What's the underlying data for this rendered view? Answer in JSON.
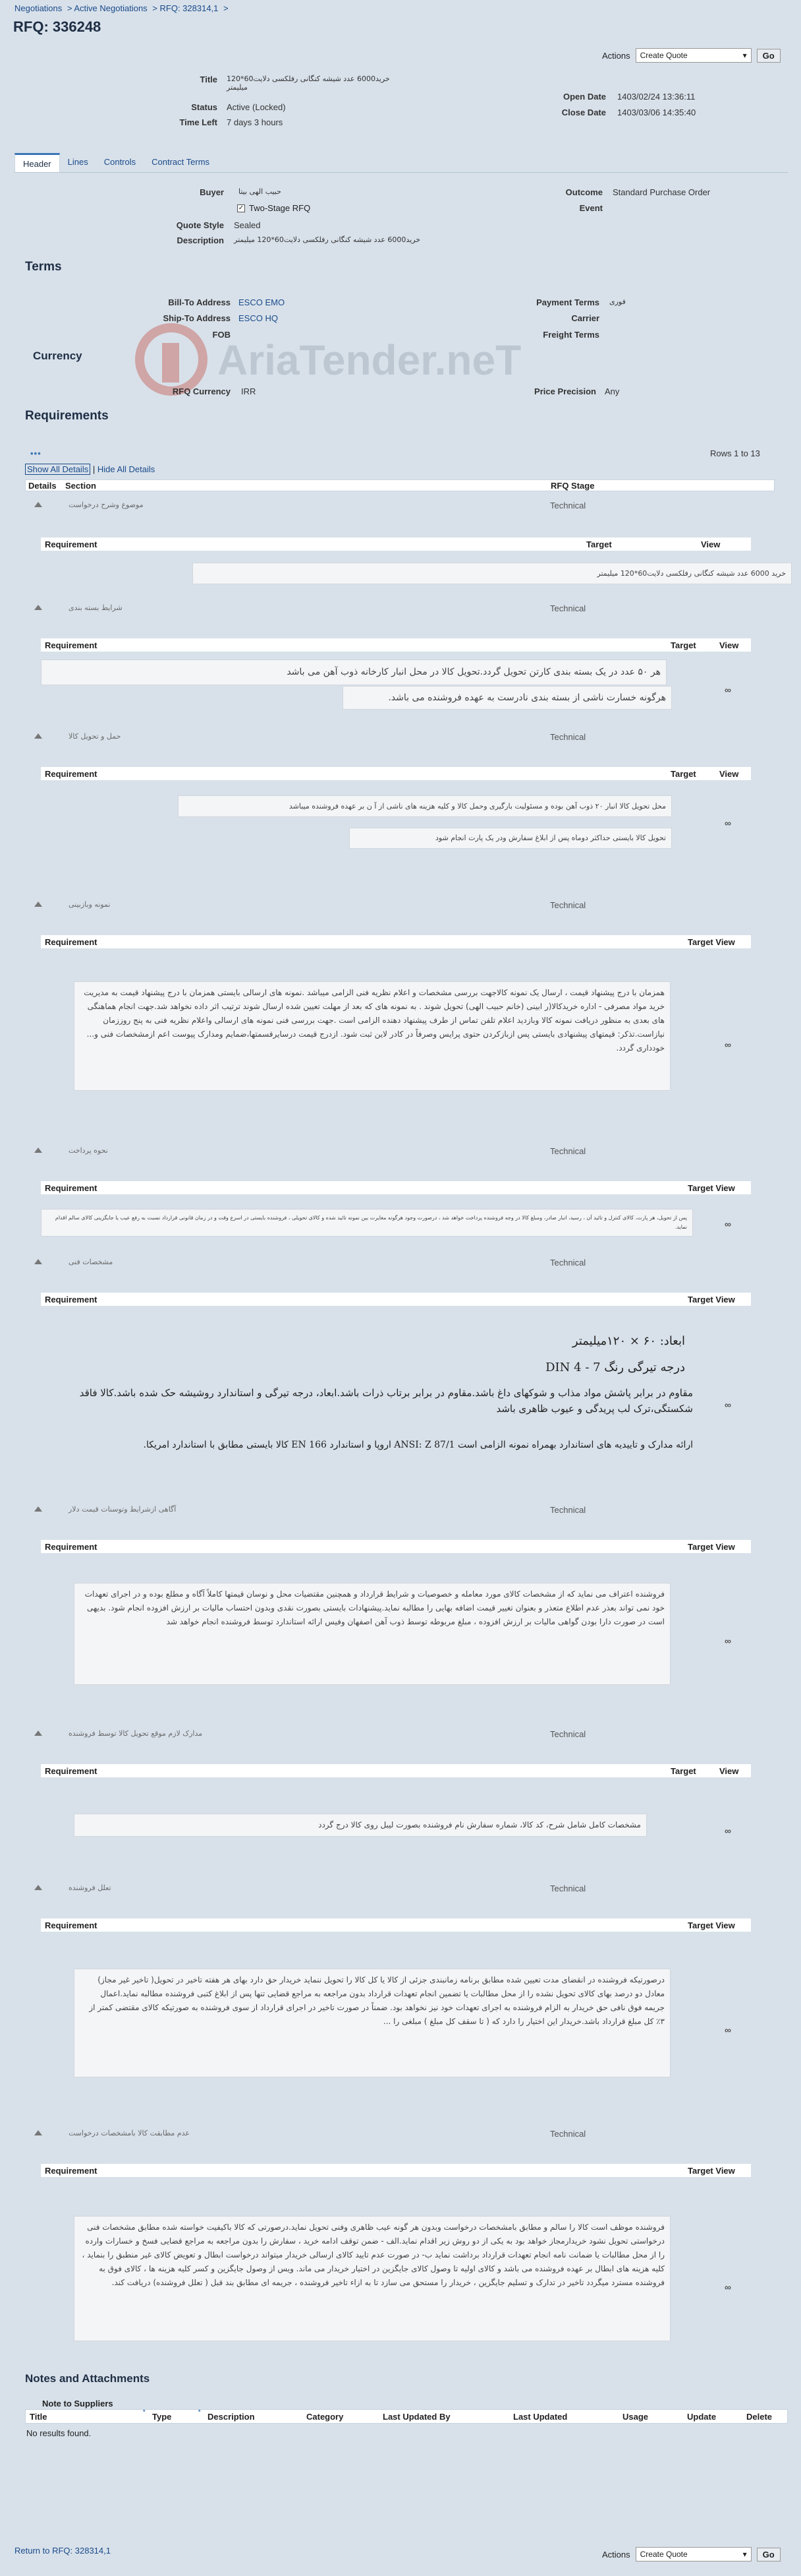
{
  "breadcrumb": [
    "Negotiations",
    "Active Negotiations",
    "RFQ: 328314,1"
  ],
  "page_title": "RFQ: 336248",
  "actions": {
    "label": "Actions",
    "selected": "Create Quote",
    "go": "Go"
  },
  "summary": {
    "title_label": "Title",
    "title_value": "خرید6000 عدد شیشه کنگانی رفلکسی دلایت60*120 میلیمتر",
    "status_label": "Status",
    "status_value": "Active (Locked)",
    "timeleft_label": "Time Left",
    "timeleft_value": "7 days 3 hours",
    "open_label": "Open Date",
    "open_value": "1403/02/24 13:36:11",
    "close_label": "Close Date",
    "close_value": "1403/03/06 14:35:40"
  },
  "tabs": [
    "Header",
    "Lines",
    "Controls",
    "Contract Terms"
  ],
  "header": {
    "buyer_label": "Buyer",
    "buyer_value": "حبیب الهی بیتا",
    "outcome_label": "Outcome",
    "outcome_value": "Standard Purchase Order",
    "event_label": "Event",
    "twostage_label": "Two-Stage RFQ",
    "style_label": "Quote Style",
    "style_value": "Sealed",
    "desc_label": "Description",
    "desc_value": "خرید6000 عدد شیشه کنگانی رفلکسی دلایت60*120 میلیمتر"
  },
  "terms": {
    "heading": "Terms",
    "billto_label": "Bill-To Address",
    "billto_value": "ESCO EMO",
    "shipto_label": "Ship-To Address",
    "shipto_value": "ESCO HQ",
    "fob_label": "FOB",
    "payment_label": "Payment Terms",
    "payment_value": "فوری",
    "carrier_label": "Carrier",
    "freight_label": "Freight Terms"
  },
  "currency": {
    "heading": "Currency",
    "rfq_label": "RFQ Currency",
    "rfq_value": "IRR",
    "precision_label": "Price Precision",
    "precision_value": "Any"
  },
  "watermark": "AriaTender.neT",
  "requirements": {
    "heading": "Requirements",
    "rows": "Rows 1 to 13",
    "show_all": "Show All Details",
    "hide_all": "Hide All Details",
    "col_details": "Details",
    "col_section": "Section",
    "col_stage": "RFQ Stage",
    "col_req": "Requirement",
    "col_target": "Target",
    "col_view": "View",
    "col_targetview": "Target View",
    "stage": "Technical",
    "eye": "∞",
    "groups": [
      {
        "name": "موضوع وشرح درخواست",
        "text": "خرید 6000 عدد شیشه کنگانی رفلکسی دلایت60*120 میلیمتر"
      },
      {
        "name": "شرایط بسته بندی",
        "text": "هر ۵۰ عدد در یک بسته بندی کارتن تحویل گردد.تحویل کالا در محل انبار کارخانه ذوب آهن می باشد",
        "text2": "هرگونه خسارت ناشی از بسته بندی نادرست به عهده فروشنده می باشد."
      },
      {
        "name": "حمل و تحویل کالا",
        "text": "محل تحویل کالا انبار ۲۰ ذوب آهن بوده و مسئولیت بارگیری وحمل کالا و کلیه هزینه های ناشی از آ ن بر عهده فروشنده میباشد",
        "text2": "تحویل کالا بایستی حداکثر دوماه پس از ابلاغ سفارش ودر یک پارت انجام شود"
      },
      {
        "name": "نمونه وبازبینی",
        "text": "همزمان با درج پیشنهاد قیمت ، ارسال یک نمونه کالاجهت بررسی مشخصات و اعلام نظریه فنی الزامی میباشد .نمونه های ارسالی بایستی همزمان با درج پیشنهاد قیمت به مدیریت خرید مواد مصرفی - اداره خریدکالا(ر ابینی (خانم حبیب الهی) تحویل شوند . به نمونه های که بعد از مهلت تعیین شده ارسال شوند ترتیب اثر داده نخواهد شد.جهت انجام هماهنگی های بعدی به منظور دریافت نمونه کالا وبازدید اعلام تلفن تماس از طرف پیشنهاد دهنده الزامی است .جهت بررسی فنی نمونه های ارسالی واعلام نظریه فنی به پنج روززمان نیازاست.تذکر: قیمتهای پیشنهادی بایستی پس ازبازکردن حتوی پرایس وصرفاً در کادر لاین ثبت شود. ازدرج قیمت درسایرقسمتها،ضمایم ومدارک پیوست اعم ازمشخصات فنی و... خودداری گردد."
      },
      {
        "name": "نحوه پرداخت",
        "text": "پس از تحویل، هر پارت، کالای کنترل و تائید آن ، رسید، انبار صادر، ومبلغ کالا در وجه فروشنده پرداخت خواهد شد ، درصورت وجود هرگونه مغایرت بین نمونه تائید شده و کالای تحویلی ، فروشنده بایستی در اسرع وقت و در زمان قانونی قرارداد نسبت به رفع عیب یا جایگزینی کالای سالم اقدام نماید."
      },
      {
        "name": "مشخصات فنی",
        "l1": "ابعاد: ۶۰ × ۱۲۰میلیمتر",
        "l2": "درجه تیرگی رنگ DIN 4 - 7",
        "l3": "مقاوم در برابر پاشش مواد مذاب و شوكهای داغ باشد.مقاوم در برابر برتاب ذرات باشد.ابعاد، درجه تیرگی و استاندارد روشیشه حک شده باشد.كالا فاقد شكستگی،ترک لب پریدگی و عیوب ظاهری باشد",
        "l4": "ارائه مدارک و تاییدیه های استاندارد بهمراه نمونه الزامی است ANSI: Z 87/1 اروپا و استاندارد EN 166 کالا بایستی مطابق با استاندارد امریکا."
      },
      {
        "name": "آگاهی ازشرایط وتوسنات قیمت دلار",
        "text": "فروشنده اعتراف می نماید که از مشخصات کالای مورد معامله و خصوصیات و شرایط قرارداد و همچنین مقتضیات محل و نوسان قیمتها کاملاً آگاه و مطلع بوده و در اجرای تعهدات خود نمی تواند بعذر عدم اطلاع متعذر و بعنوان تغییر قیمت اضافه بهایی را مطالبه نماید.پیشنهادات بایستی بصورت نقدی وبدون احتساب مالیات بر ارزش افزوده انجام شود. بدیهی است در صورت دارا بودن گواهی مالیات بر ارزش افزوده ، مبلغ مربوطه توسط ذوب آهن اصفهان وفیس ارائه استاندارد توسط فروشنده انجام خواهد شد"
      },
      {
        "name": "مدارک لازم موقع تحویل کالا توسط فروشنده",
        "text": "مشخصات کامل شامل شرح، کد کالا، شماره سفارش نام فروشنده بصورت لیبل روی کالا درج گردد"
      },
      {
        "name": "تعلل فروشنده",
        "text": "درصورتیکه فروشنده در انقضای مدت تعیین شده مطابق برنامه زمانبندی جزئی از کالا یا کل کالا را تحویل ننماید خریدار حق دارد بهای هر هفته تاخیر در تحویل( تاخیر غیر مجاز) معادل دو درصد بهای کالای تحویل نشده را از محل مطالبات یا تضمین انجام تعهدات قرارداد بدون مراجعه به مراجع قضایی تنها پس از ابلاغ کتبی فروشنده مطالبه نماید.اعمال جریمه فوق نافی حق خریدار به الزام فروشنده به اجرای تعهدات خود نیز نخواهد بود. ضمناً در صورت تاخیر در اجرای قرارداد از سوی فروشنده به صورتیکه کالای مقتضی کمتر از ۳٪ کل مبلغ قرارداد باشد.خریدار این اختیار را دارد که ( تا سقف کل مبلغ ) مبلغی را ..."
      },
      {
        "name": "عدم مطابقت کالا بامشخصات درخواست",
        "text": "فروشنده موظف است کالا را سالم و مطابق بامشخصات درخواست وبدون هر گونه عیب ظاهری وفنی تحویل نماید.درصورتی که کالا باکیفیت خواسته شده مطابق مشخصات فنی درخواستی تحویل نشود خریدارمجاز خواهد بود به یکی از دو روش زیر اقدام نماید.الف - ضمن توقف ادامه خرید ، سفارش را بدون مراجعه به مراجع قضایی فسخ و خسارات وارده را از محل مطالبات یا ضمانت نامه انجام تعهدات قرارداد برداشت نماید ب- در صورت عدم تایید کالای ارسالی خریدار ميتواند درخواست ابطال و تعویض کالای غیر منطبق را بنماید ، کلیه هزینه های ابطال بر عهده فروشنده می باشد و کالای اولیه تا وصول کالای جایگزین در اختیار خریدار می ماند. ویس از وصول جایگزین و کسر کلیه هزینه ها ، کالای فوق به فروشنده مسترد میگردد تاخیر در تدارک و تسلیم جایگزین ، خریدار را مستحق می سازد تا به ازاء تاخیر فروشنده ، جریمه ای مطابق بند قبل ( تعلل فروشنده) دریافت کند."
      }
    ]
  },
  "notes": {
    "heading": "Notes and Attachments",
    "sub": "Note to Suppliers",
    "cols": [
      "Title",
      "Type",
      "Description",
      "Category",
      "Last Updated By",
      "Last Updated",
      "Usage",
      "Update",
      "Delete"
    ],
    "empty": "No results found."
  },
  "footer": {
    "return": "Return to RFQ: 328314,1",
    "actions": "Actions",
    "selected": "Create Quote",
    "go": "Go"
  }
}
